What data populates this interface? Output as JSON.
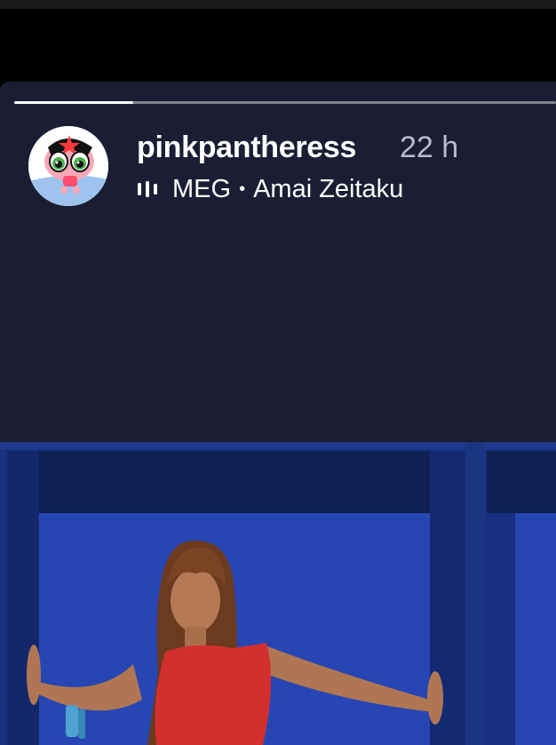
{
  "story": {
    "progress": 0.22,
    "username": "pinkpantheress",
    "timestamp": "22 h",
    "music": {
      "icon": "music-bars-icon",
      "title": "MEG",
      "separator": "•",
      "artist": "Amai Zeitaku"
    },
    "avatar_icon": "cartoon-character-avatar"
  },
  "colors": {
    "background": "#1b1e33",
    "progress_track": "#8a8b95",
    "progress_fill": "#ffffff",
    "photo_blue": "#1e3a8a",
    "text_primary": "#ffffff",
    "text_secondary": "#b9bcc8"
  }
}
